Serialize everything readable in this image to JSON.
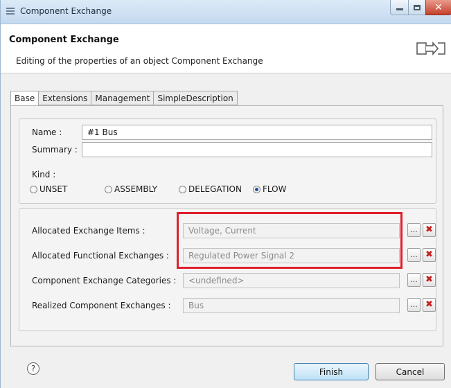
{
  "window": {
    "title": "Component Exchange"
  },
  "header": {
    "title": "Component Exchange",
    "description": "Editing of the properties of an object Component Exchange"
  },
  "tabs": [
    {
      "label": "Base",
      "active": true
    },
    {
      "label": "Extensions",
      "active": false
    },
    {
      "label": "Management",
      "active": false
    },
    {
      "label": "SimpleDescription",
      "active": false
    }
  ],
  "base": {
    "name_label": "Name :",
    "name_value": "#1 Bus",
    "summary_label": "Summary :",
    "summary_value": "",
    "kind_label": "Kind :",
    "kind_options": [
      "UNSET",
      "ASSEMBLY",
      "DELEGATION",
      "FLOW"
    ],
    "kind_selected": "FLOW"
  },
  "allocations": [
    {
      "label": "Allocated Exchange Items :",
      "value": "Voltage, Current"
    },
    {
      "label": "Allocated Functional Exchanges :",
      "value": "Regulated Power Signal 2"
    },
    {
      "label": "Component Exchange Categories :",
      "value": "<undefined>"
    },
    {
      "label": "Realized Component Exchanges :",
      "value": "Bus"
    }
  ],
  "row_buttons": {
    "browse": "...",
    "delete": "✖"
  },
  "footer": {
    "help": "?",
    "finish_label": "Finish",
    "cancel_label": "Cancel"
  },
  "colors": {
    "highlight": "#e01e2b",
    "selected_tab": "#ffffff",
    "delete": "#c62020"
  }
}
